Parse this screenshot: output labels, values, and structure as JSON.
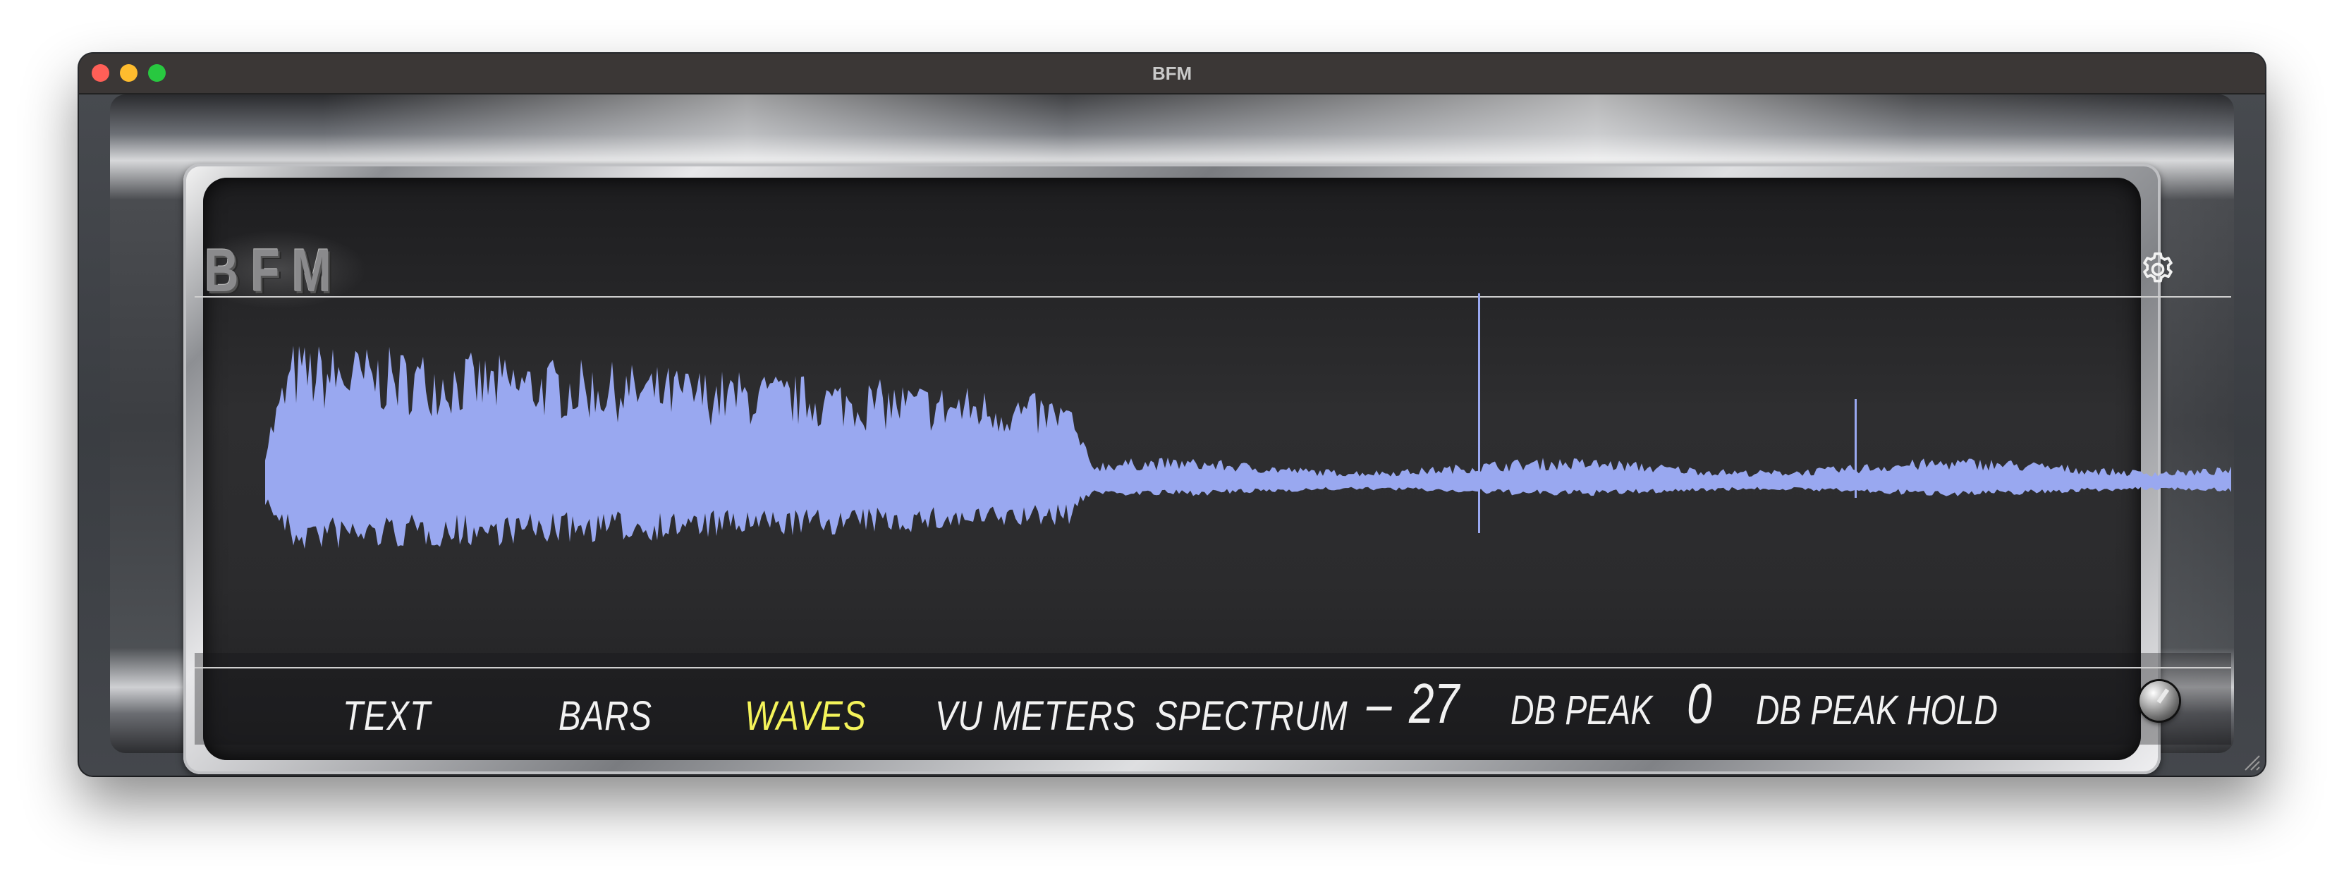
{
  "window": {
    "title": "BFM"
  },
  "app": {
    "logo_text": "BFM",
    "icons": {
      "settings": "gear-icon",
      "knob": "knob-control"
    },
    "colors": {
      "waveform": "#99a8f0",
      "active_mode": "#f4f35a",
      "inactive_mode": "#f2f2f2"
    }
  },
  "modes": {
    "text": "TEXT",
    "bars": "BARS",
    "waves": "WAVES",
    "vu_meters": "VU METERS",
    "spectrum": "SPECTRUM",
    "active": "WAVES"
  },
  "meters": {
    "peak_sign": "–",
    "peak_value": "27",
    "peak_unit": "DB PEAK",
    "peak_hold_value": "0",
    "peak_hold_unit": "DB PEAK  HOLD"
  }
}
